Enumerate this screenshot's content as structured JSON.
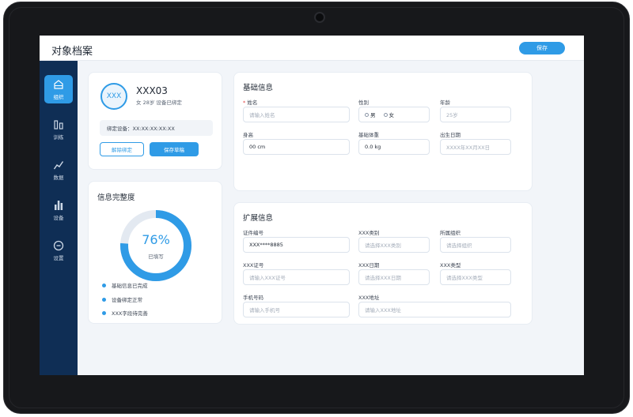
{
  "header": {
    "title": "对象档案",
    "save_label": "保存"
  },
  "sidebar": {
    "items": [
      {
        "icon": "building-icon",
        "label": "组织",
        "active": true
      },
      {
        "icon": "training-icon",
        "label": "训练",
        "active": false
      },
      {
        "icon": "chart-line-icon",
        "label": "数据",
        "active": false
      },
      {
        "icon": "bar-chart-icon",
        "label": "设备",
        "active": false
      },
      {
        "icon": "settings-icon",
        "label": "设置",
        "active": false
      }
    ]
  },
  "profile": {
    "avatar_text": "XXX",
    "name": "XXX03",
    "meta": "女  28岁  设备已绑定",
    "bound_device": "绑定设备：XX:XX:XX:XX:XX",
    "unbind_label": "解除绑定",
    "save_draft_label": "保存草稿"
  },
  "completeness": {
    "title": "信息完整度",
    "percent": 76,
    "percent_text": "76%",
    "status": "已填写",
    "checklist": [
      "基础信息已完成",
      "设备绑定正常",
      "XXX字段待完善"
    ]
  },
  "basic_info": {
    "title": "基础信息",
    "name": {
      "label": "姓名",
      "required_mark": "*",
      "placeholder": "请输入姓名"
    },
    "gender": {
      "label": "性别",
      "options": [
        "男",
        "女"
      ]
    },
    "age": {
      "label": "年龄",
      "placeholder": "25岁"
    },
    "height": {
      "label": "身高",
      "value": "00 cm"
    },
    "weight": {
      "label": "基础体重",
      "value": "0.0 kg"
    },
    "birthdate": {
      "label": "出生日期",
      "placeholder": "XXXX年XX月XX日"
    }
  },
  "extended_info": {
    "title": "扩展信息",
    "id_number": {
      "label": "证件编号",
      "value": "XXX****8885"
    },
    "category": {
      "label": "XXX类别",
      "placeholder": "请选择XXX类别"
    },
    "organization": {
      "label": "所属组织",
      "placeholder": "请选择组织"
    },
    "cert_number": {
      "label": "XXX证号",
      "placeholder": "请输入XXX证号"
    },
    "date": {
      "label": "XXX日期",
      "placeholder": "请选择XXX日期"
    },
    "type": {
      "label": "XXX类型",
      "placeholder": "请选择XXX类型"
    },
    "phone": {
      "label": "手机号码",
      "placeholder": "请输入手机号"
    },
    "address": {
      "label": "XXX地址",
      "placeholder": "请输入XXX地址"
    }
  },
  "colors": {
    "accent": "#2f9be6",
    "sidebar": "#0f2e55",
    "donut_track": "#e3e9f1"
  }
}
